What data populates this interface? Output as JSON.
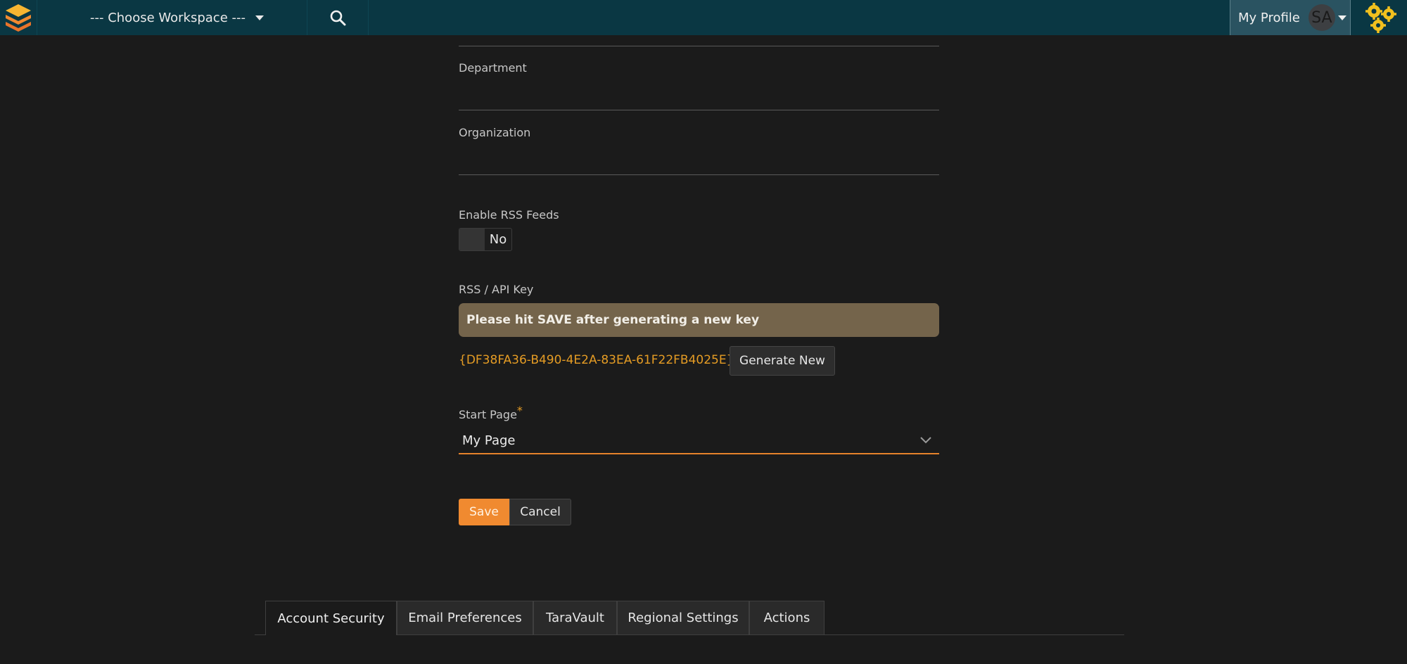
{
  "header": {
    "workspace_label": "--- Choose Workspace ---",
    "profile_label": "My Profile",
    "avatar_initials": "SA"
  },
  "form": {
    "department_label": "Department",
    "department_value": "",
    "organization_label": "Organization",
    "organization_value": "",
    "rss_label": "Enable RSS Feeds",
    "rss_toggle_value": "No",
    "api_key_label": "RSS / API Key",
    "api_notice": "Please hit SAVE after generating a new key",
    "api_key_value": "{DF38FA36-B490-4E2A-83EA-61F22FB4025E}",
    "generate_label": "Generate New",
    "start_page_label": "Start Page",
    "required_marker": "*",
    "start_page_value": "My Page",
    "save_label": "Save",
    "cancel_label": "Cancel"
  },
  "tabs": [
    {
      "label": "Account Security",
      "active": true
    },
    {
      "label": "Email Preferences",
      "active": false
    },
    {
      "label": "TaraVault",
      "active": false
    },
    {
      "label": "Regional Settings",
      "active": false
    },
    {
      "label": "Actions",
      "active": false
    }
  ],
  "colors": {
    "header_bg": "#0a3743",
    "page_bg": "#1b1b1b",
    "accent_orange": "#f08a30",
    "key_color": "#e59c24",
    "notice_bg": "#74644b"
  },
  "icons": {
    "logo": "stacked-layers-logo",
    "search": "search-icon",
    "settings": "gears-icon"
  }
}
